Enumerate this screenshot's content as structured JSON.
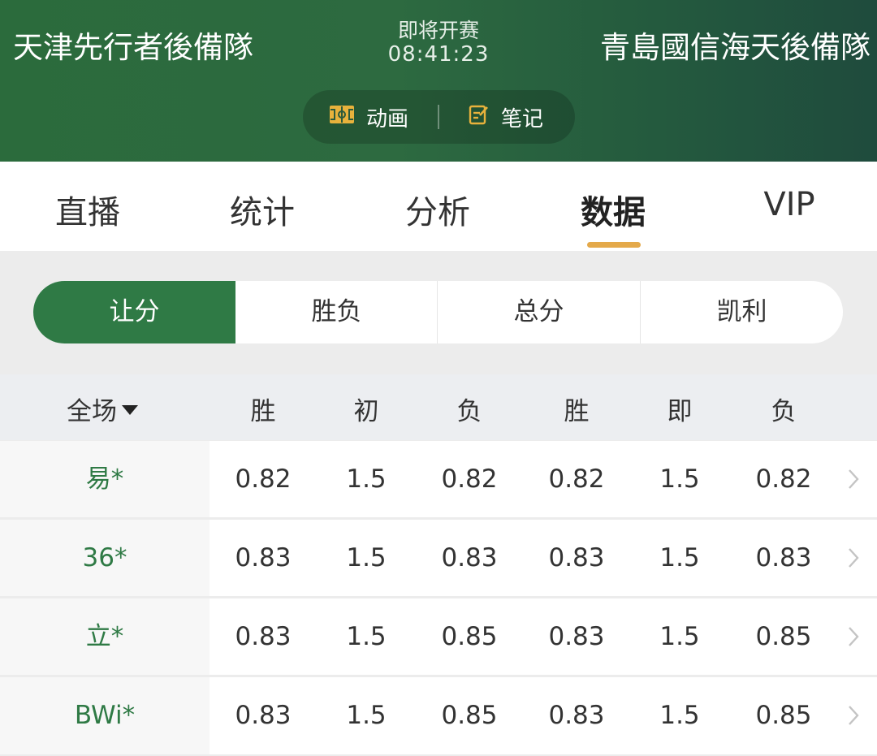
{
  "header": {
    "home_team": "天津先行者後備隊",
    "away_team": "青島國信海天後備隊",
    "status": "即将开赛",
    "countdown": "08:41:23",
    "animation_label": "动画",
    "notes_label": "笔记"
  },
  "tabs": [
    {
      "label": "直播"
    },
    {
      "label": "统计"
    },
    {
      "label": "分析"
    },
    {
      "label": "数据",
      "active": true
    },
    {
      "label": "VIP"
    }
  ],
  "segments": [
    {
      "label": "让分",
      "active": true
    },
    {
      "label": "胜负"
    },
    {
      "label": "总分"
    },
    {
      "label": "凯利"
    }
  ],
  "table": {
    "scope_label": "全场",
    "columns": [
      "胜",
      "初",
      "负",
      "胜",
      "即",
      "负"
    ],
    "rows": [
      {
        "company": "易*",
        "values": [
          "0.82",
          "1.5",
          "0.82",
          "0.82",
          "1.5",
          "0.82"
        ]
      },
      {
        "company": "36*",
        "values": [
          "0.83",
          "1.5",
          "0.83",
          "0.83",
          "1.5",
          "0.83"
        ]
      },
      {
        "company": "立*",
        "values": [
          "0.83",
          "1.5",
          "0.85",
          "0.83",
          "1.5",
          "0.85"
        ]
      },
      {
        "company": "BWi*",
        "values": [
          "0.83",
          "1.5",
          "0.85",
          "0.83",
          "1.5",
          "0.85"
        ]
      }
    ]
  },
  "colors": {
    "brand_green": "#2f7a45",
    "accent_orange": "#e4a94a",
    "icon_gold": "#e8b23c"
  }
}
